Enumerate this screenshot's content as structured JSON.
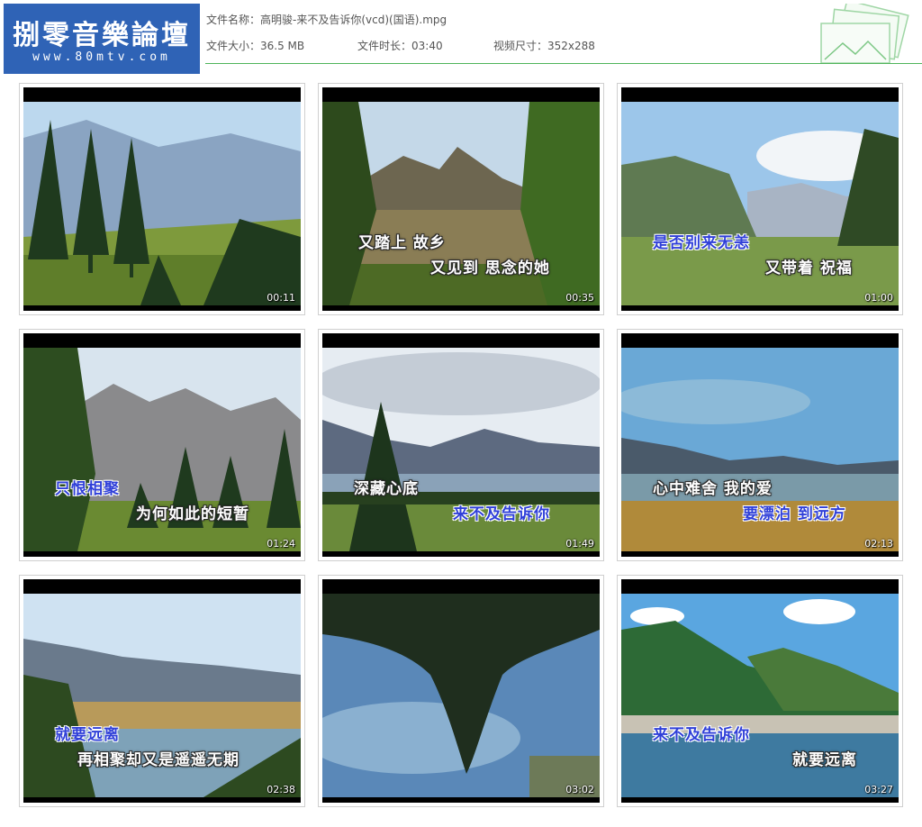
{
  "logo": {
    "title": "捌零音樂論壇",
    "url": "www.80mtv.com"
  },
  "info": {
    "name_label": "文件名称：",
    "name_value": "高明骏-来不及告诉你(vcd)(国语).mpg",
    "size_label": "文件大小：",
    "size_value": "36.5 MB",
    "duration_label": "文件时长：",
    "duration_value": "03:40",
    "dims_label": "视频尺寸：",
    "dims_value": "352x288"
  },
  "colors": {
    "logo_bg": "#2f63b6",
    "accent_line": "#4fb45a",
    "subtitle_blue": "#2f3fd8"
  },
  "thumbnails": [
    {
      "time": "00:11",
      "line1": "",
      "line2": ""
    },
    {
      "time": "00:35",
      "line1": "又踏上 故乡",
      "line2": "又见到 思念的她"
    },
    {
      "time": "01:00",
      "line1": "是否别来无恙",
      "line2": "又带着 祝福"
    },
    {
      "time": "01:24",
      "line1": "只恨相聚",
      "line2": "为何如此的短暂"
    },
    {
      "time": "01:49",
      "line1": "深藏心底",
      "line2": "来不及告诉你"
    },
    {
      "time": "02:13",
      "line1": "心中难舍 我的爱",
      "line2": "要漂泊 到远方"
    },
    {
      "time": "02:38",
      "line1": "就要远离",
      "line2": "再相聚却又是遥遥无期"
    },
    {
      "time": "03:02",
      "line1": "",
      "line2": ""
    },
    {
      "time": "03:27",
      "line1": "来不及告诉你",
      "line2": "就要远离"
    }
  ]
}
